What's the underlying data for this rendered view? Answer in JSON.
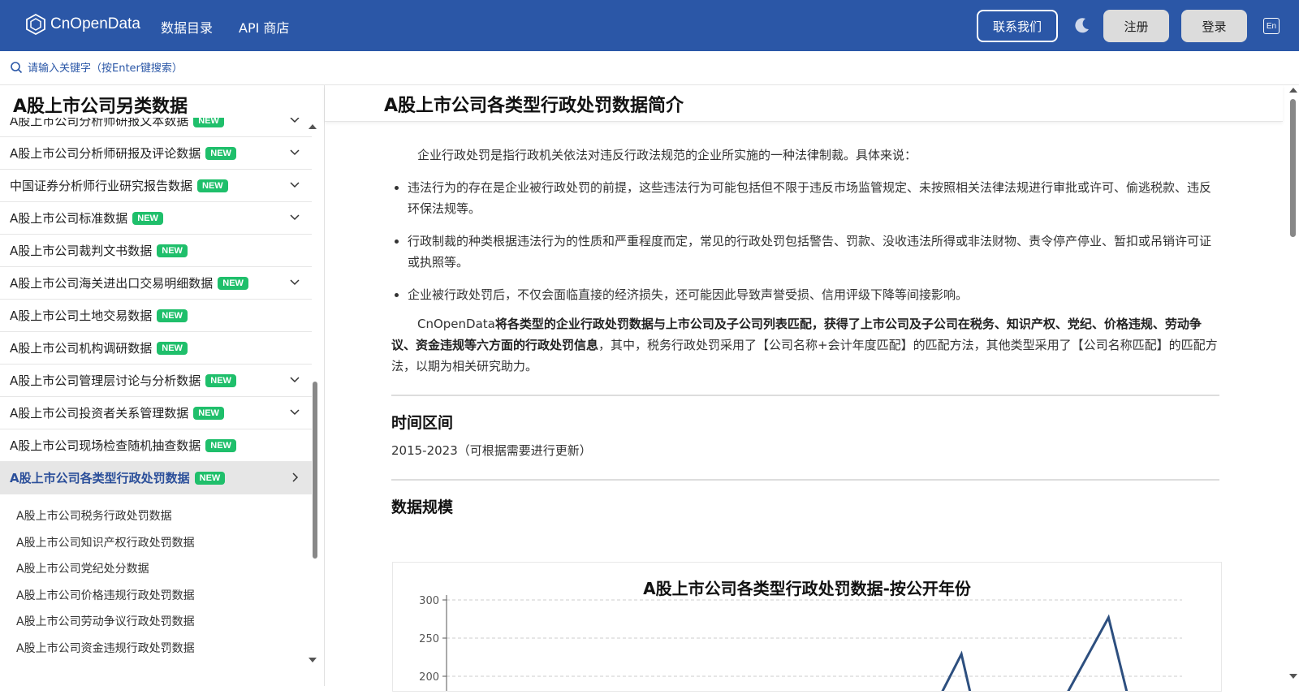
{
  "brand": {
    "name": "CnOpenData"
  },
  "nav": {
    "data_catalog": "数据目录",
    "api_store": "API 商店",
    "contact": "联系我们",
    "register": "注册",
    "login": "登录",
    "lang": "En"
  },
  "search": {
    "placeholder": "请输入关键字（按Enter键搜索）"
  },
  "sidebar": {
    "title": "A股上市公司另类数据",
    "items": [
      {
        "label": "A股上市公司分析师研报文本数据",
        "badge": "NEW",
        "chevron": "down"
      },
      {
        "label": "A股上市公司分析师研报及评论数据",
        "badge": "NEW",
        "chevron": "down"
      },
      {
        "label": "中国证券分析师行业研究报告数据",
        "badge": "NEW",
        "chevron": "down"
      },
      {
        "label": "A股上市公司标准数据",
        "badge": "NEW",
        "chevron": "down"
      },
      {
        "label": "A股上市公司裁判文书数据",
        "badge": "NEW",
        "chevron": ""
      },
      {
        "label": "A股上市公司海关进出口交易明细数据",
        "badge": "NEW",
        "chevron": "down"
      },
      {
        "label": "A股上市公司土地交易数据",
        "badge": "NEW",
        "chevron": ""
      },
      {
        "label": "A股上市公司机构调研数据",
        "badge": "NEW",
        "chevron": ""
      },
      {
        "label": "A股上市公司管理层讨论与分析数据",
        "badge": "NEW",
        "chevron": "down"
      },
      {
        "label": "A股上市公司投资者关系管理数据",
        "badge": "NEW",
        "chevron": "down"
      },
      {
        "label": "A股上市公司现场检查随机抽查数据",
        "badge": "NEW",
        "chevron": ""
      },
      {
        "label": "A股上市公司各类型行政处罚数据",
        "badge": "NEW",
        "chevron": "right",
        "active": true
      }
    ],
    "sub_items": [
      "A股上市公司税务行政处罚数据",
      "A股上市公司知识产权行政处罚数据",
      "A股上市公司党纪处分数据",
      "A股上市公司价格违规行政处罚数据",
      "A股上市公司劳动争议行政处罚数据",
      "A股上市公司资金违规行政处罚数据"
    ]
  },
  "main": {
    "title": "A股上市公司各类型行政处罚数据简介",
    "intro": "企业行政处罚是指行政机关依法对违反行政法规范的企业所实施的一种法律制裁。具体来说：",
    "bullets": [
      "违法行为的存在是企业被行政处罚的前提，这些违法行为可能包括但不限于违反市场监管规定、未按照相关法律法规进行审批或许可、偷逃税款、违反环保法规等。",
      "行政制裁的种类根据违法行为的性质和严重程度而定，常见的行政处罚包括警告、罚款、没收违法所得或非法财物、责令停产停业、暂扣或吊销许可证或执照等。",
      "企业被行政处罚后，不仅会面临直接的经济损失，还可能因此导致声誉受损、信用评级下降等间接影响。"
    ],
    "summary_prefix": "CnOpenData",
    "summary_bold": "将各类型的企业行政处罚数据与上市公司及子公司列表匹配，获得了上市公司及子公司在税务、知识产权、党纪、价格违规、劳动争议、资金违规等六方面的行政处罚信息",
    "summary_rest": "，其中，税务行政处罚采用了【公司名称+会计年度匹配】的匹配方法，其他类型采用了【公司名称匹配】的匹配方法，以期为相关研究助力。",
    "time_title": "时间区间",
    "time_value": "2015-2023（可根据需要进行更新）",
    "scale_title": "数据规模"
  },
  "chart_data": {
    "type": "line",
    "title": "A股上市公司各类型行政处罚数据-按公开年份",
    "yticks": [
      300,
      250,
      200
    ],
    "ylim": [
      200,
      300
    ],
    "grid": true,
    "color": "#2d4f7f",
    "series_visible_peaks": [
      {
        "x": 0.7,
        "y": 229
      },
      {
        "x": 0.9,
        "y": 277
      }
    ]
  }
}
